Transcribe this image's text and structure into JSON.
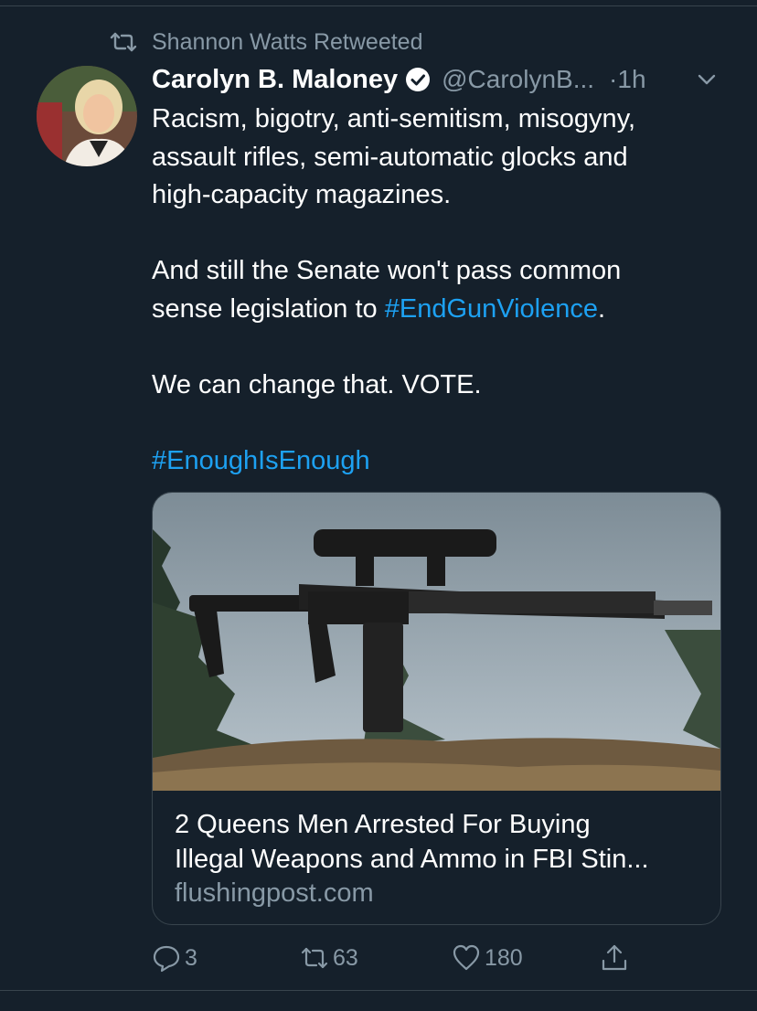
{
  "retweet": {
    "text": "Shannon Watts Retweeted"
  },
  "tweet": {
    "author_name": "Carolyn B. Maloney",
    "handle": "@CarolynB...",
    "time": "·1h",
    "lines": [
      "Racism, bigotry, anti-semitism, misogyny,",
      "assault rifles, semi-automatic glocks and",
      "high-capacity magazines."
    ],
    "para2_line1": "And still the Senate won't pass common",
    "para2_line2_prefix": "sense legislation to ",
    "hashtag1": "#EndGunViolence",
    "para2_suffix": ".",
    "para3": "We can change that. VOTE.",
    "hashtag2": "#EnoughIsEnough"
  },
  "card": {
    "title_line1": "2 Queens Men Arrested For Buying",
    "title_line2": "Illegal Weapons and Ammo in FBI Stin...",
    "domain": "flushingpost.com"
  },
  "actions": {
    "reply_count": "3",
    "retweet_count": "63",
    "like_count": "180"
  },
  "icons": {
    "retweet": "retweet-icon",
    "verified": "verified-badge-icon",
    "chevron": "chevron-down-icon",
    "reply": "reply-icon",
    "like": "heart-icon",
    "share": "share-icon"
  },
  "colors": {
    "background": "#15202b",
    "link": "#1da1f2",
    "secondary_text": "#8899a6",
    "border": "#38444d"
  }
}
